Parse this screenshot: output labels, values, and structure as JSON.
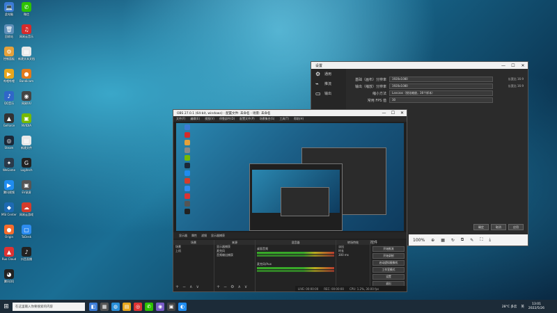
{
  "desktop": {
    "icons": [
      {
        "label": "此电脑",
        "glyph": "💻",
        "color": "#3b7bd6"
      },
      {
        "label": "微信",
        "glyph": "✆",
        "color": "#2dc100"
      },
      {
        "label": "回收站",
        "glyph": "🗑",
        "color": "#5f8fb8"
      },
      {
        "label": "网易云音乐",
        "glyph": "♫",
        "color": "#d52b2b"
      },
      {
        "label": "控制面板",
        "glyph": "⚙",
        "color": "#e5a13b"
      },
      {
        "label": "新建文本文档",
        "glyph": "▤",
        "color": "#e8e8e8"
      },
      {
        "label": "哔哩哔哩",
        "glyph": "▶",
        "color": "#e8a61c"
      },
      {
        "label": "Bandicam",
        "glyph": "●",
        "color": "#e07a1c"
      },
      {
        "label": "QQ音乐",
        "glyph": "♪",
        "color": "#2f67c8"
      },
      {
        "label": "网易UU",
        "glyph": "◉",
        "color": "#444"
      },
      {
        "label": "GeForce",
        "glyph": "▲",
        "color": "#333"
      },
      {
        "label": "NVIDIA",
        "glyph": "▣",
        "color": "#76b900"
      },
      {
        "label": "Steam",
        "glyph": "◎",
        "color": "#1b2838"
      },
      {
        "label": "新建文件",
        "glyph": "▤",
        "color": "#e8e8e8"
      },
      {
        "label": "WeGame",
        "glyph": "✦",
        "color": "#2a3a4a"
      },
      {
        "label": "Logitech",
        "glyph": "G",
        "color": "#222"
      },
      {
        "label": "腾讯视频",
        "glyph": "▶",
        "color": "#1f8cf0"
      },
      {
        "label": "EV录屏",
        "glyph": "▣",
        "color": "#555"
      },
      {
        "label": "MSI Center",
        "glyph": "◆",
        "color": "#1d6ab3"
      },
      {
        "label": "网易云游戏",
        "glyph": "☁",
        "color": "#d43c2c"
      },
      {
        "label": "Origin",
        "glyph": "●",
        "color": "#f56c2d"
      },
      {
        "label": "ToDesk",
        "glyph": "▢",
        "color": "#2d8cf0"
      },
      {
        "label": "Ruo Cloud",
        "glyph": "▲",
        "color": "#d33"
      },
      {
        "label": "抖音直播",
        "glyph": "♪",
        "color": "#222"
      },
      {
        "label": "腾讯QQ",
        "glyph": "◕",
        "color": "#222"
      }
    ]
  },
  "settings_window": {
    "title": "设置",
    "controls": [
      "—",
      "☐",
      "✕"
    ],
    "sidebar": [
      {
        "label": "通用",
        "icon": "⚙"
      },
      {
        "label": "推流",
        "icon": "⌁"
      },
      {
        "label": "输出",
        "icon": "▭"
      }
    ],
    "rows": [
      {
        "label": "基础（画布）分辨率",
        "value": "1920x1080",
        "extra": "长宽比 16:9"
      },
      {
        "label": "输出（缩放）分辨率",
        "value": "1920x1080",
        "extra": "长宽比 16:9"
      },
      {
        "label": "缩小方法",
        "value": "Lanczos（锐化缩放，36个样本）",
        "extra": ""
      },
      {
        "label": "常用 FPS 值",
        "value": "30",
        "extra": ""
      }
    ],
    "footer_buttons": [
      "确定",
      "取消",
      "应用"
    ],
    "zoom": {
      "value": "100%"
    }
  },
  "obs_window": {
    "title": "OBS 27.0.1 (64-bit, windows) - 配置文件: 未命名 - 场景: 未命名",
    "controls": [
      "—",
      "☐",
      "✕"
    ],
    "menu": [
      "文件(F)",
      "编辑(E)",
      "视图(V)",
      "停靠部件(D)",
      "配置文件(P)",
      "场景集合(S)",
      "工具(T)",
      "帮助(H)"
    ],
    "source_bar": [
      "显示器",
      "属性",
      "滤镜",
      "显示器捕获"
    ],
    "docks": {
      "scenes": {
        "title": "场景",
        "items": [
          "场景",
          "上机"
        ]
      },
      "sources": {
        "title": "来源",
        "items": [
          "显示器捕获",
          "麦克风",
          "音频输出捕获"
        ]
      },
      "mixer": {
        "title": "混音器",
        "tracks": [
          {
            "name": "桌面音频",
            "level": "0.0 dB"
          },
          {
            "name": "麦克风/Aux",
            "level": "0.0 dB"
          }
        ]
      },
      "transitions": {
        "title": "转场特效",
        "type": "淡出",
        "duration_label": "时长",
        "duration": "300 ms"
      },
      "controls": {
        "title": "控件",
        "buttons": [
          "开始推流",
          "开始录制",
          "启动虚拟摄像机",
          "工作室模式",
          "设置",
          "退出"
        ]
      }
    },
    "status": {
      "live": "LIVE: 00:00:00",
      "rec": "REC: 00:00:00",
      "cpu": "CPU: 1.2%, 30.00 fps"
    }
  },
  "taskbar": {
    "search_placeholder": "在这里输入你要搜索的内容",
    "apps": [
      {
        "glyph": "◧",
        "color": "#3b7bd6"
      },
      {
        "glyph": "▦",
        "color": "#555"
      },
      {
        "glyph": "◍",
        "color": "#2a8fd8"
      },
      {
        "glyph": "▤",
        "color": "#e8a61c"
      },
      {
        "glyph": "◎",
        "color": "#d33"
      },
      {
        "glyph": "✆",
        "color": "#2dc100"
      },
      {
        "glyph": "◉",
        "color": "#7a5cc7"
      },
      {
        "glyph": "▣",
        "color": "#444"
      },
      {
        "glyph": "◐",
        "color": "#1f8cf0"
      }
    ],
    "tray_text": "28°C 多云",
    "ime": "英",
    "time": "13:01",
    "date": "2022/5/26"
  }
}
